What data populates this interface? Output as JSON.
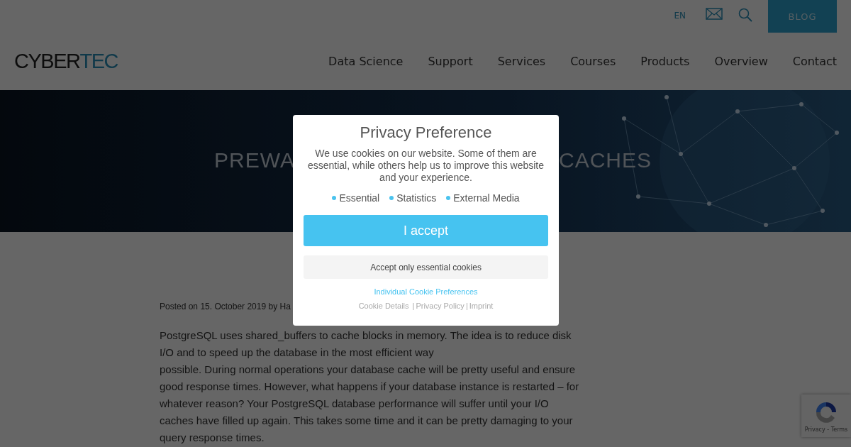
{
  "header": {
    "language": "EN",
    "blog_button": "BLOG",
    "logo": "CYBER**TEC**",
    "nav": [
      "Data Science",
      "Support",
      "Services",
      "Courses",
      "Products",
      "Overview",
      "Contact"
    ]
  },
  "hero": {
    "title_left": "PREWA",
    "title_right": "CACHES"
  },
  "article": {
    "posted_on": "Posted on",
    "date": "15. October 2019",
    "by": "by",
    "author": "Ha",
    "lines": [
      "PostgreSQL uses shared_buffers to cache blocks in memory. The idea is to reduce disk I/O and to speed up the database in the most efficient way",
      "possible. During normal operations your database cache will be pretty useful and ensure good response times. However, what happens if your database instance is restarted – for whatever reason? Your PostgreSQL database performance will suffer until your I/O caches have filled up again. This takes some time and it can be pretty damaging to your query response times."
    ]
  },
  "recaptcha": {
    "links": "Privacy - Terms"
  },
  "dialog": {
    "title": "Privacy Preference",
    "text": "We use cookies on our website. Some of them are essential, while others help us to improve this website and your experience.",
    "categories": [
      "Essential",
      "Statistics",
      "External Media"
    ],
    "accept_button": "I accept",
    "essential_button": "Accept only essential cookies",
    "preferences_link": "Individual Cookie Preferences",
    "footer": {
      "details": "Cookie Details",
      "separator": "|",
      "privacy": "Privacy Policy",
      "separator_2": "|",
      "imprint": "Imprint"
    }
  }
}
